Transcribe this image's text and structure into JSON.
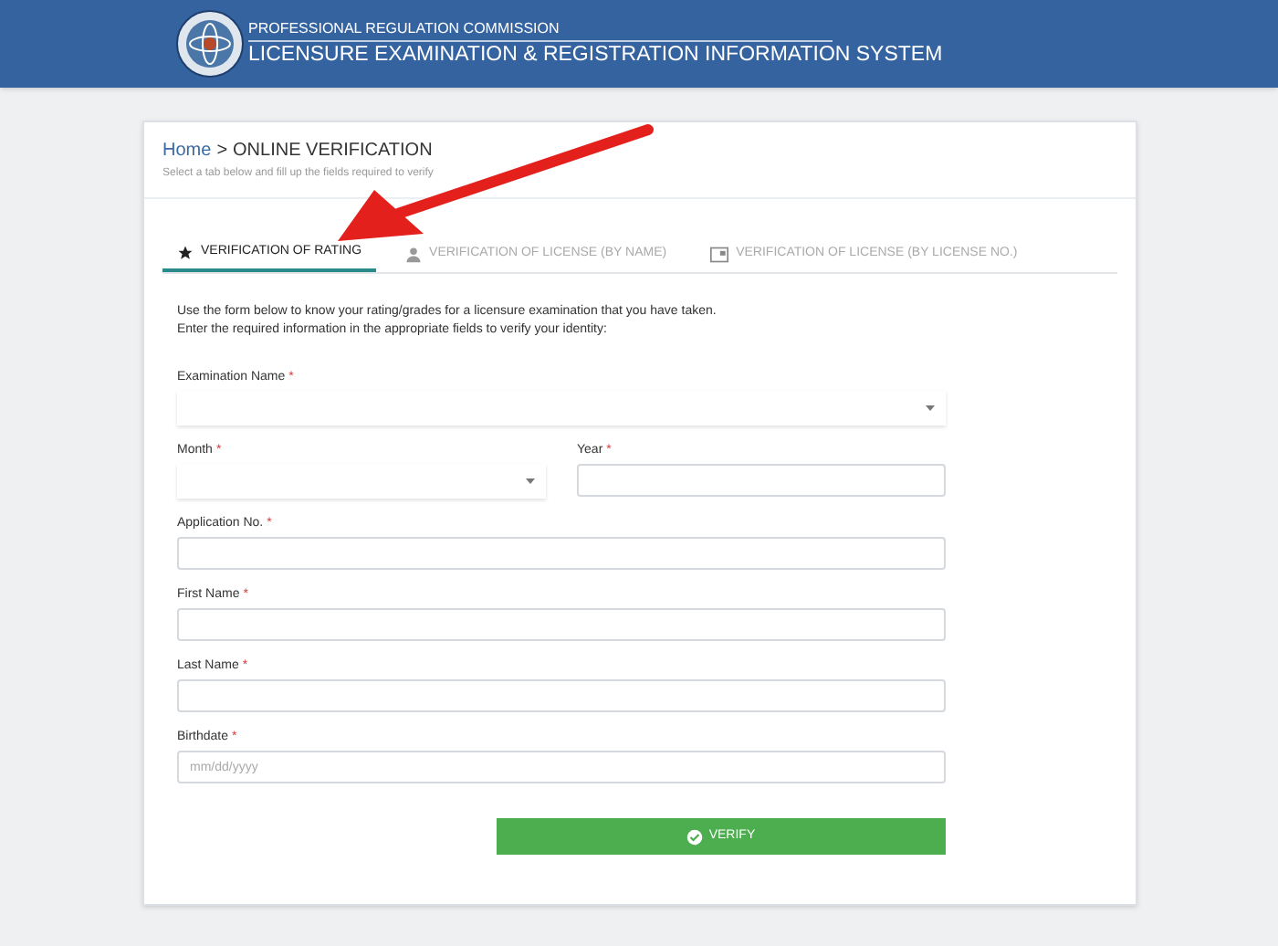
{
  "header": {
    "org": "PROFESSIONAL REGULATION COMMISSION",
    "system": "LICENSURE EXAMINATION & REGISTRATION INFORMATION SYSTEM"
  },
  "breadcrumb": {
    "home": "Home",
    "separator": ">",
    "current": "ONLINE VERIFICATION",
    "subtitle": "Select a tab below and fill up the fields required to verify"
  },
  "tabs": [
    {
      "label": "VERIFICATION OF RATING",
      "selected": true
    },
    {
      "label": "VERIFICATION OF LICENSE (BY NAME)",
      "selected": false
    },
    {
      "label": "VERIFICATION OF LICENSE (BY LICENSE NO.)",
      "selected": false
    }
  ],
  "instructions": [
    "Use the form below to know your rating/grades for a licensure examination that you have taken.",
    "Enter the required information in the appropriate fields to verify your identity:"
  ],
  "fields": [
    {
      "label": "Examination Name",
      "required_mark": "*",
      "kind": "select"
    },
    {
      "label": "Month",
      "required_mark": "*",
      "kind": "select"
    },
    {
      "label": "Year",
      "required_mark": "*",
      "kind": "input"
    },
    {
      "label": "Application No.",
      "required_mark": "*",
      "kind": "input"
    },
    {
      "label": "First Name",
      "required_mark": "*",
      "kind": "input"
    },
    {
      "label": "Last Name",
      "required_mark": "*",
      "kind": "input"
    },
    {
      "label": "Birthdate",
      "required_mark": "*",
      "kind": "input",
      "placeholder": "mm/dd/yyyy"
    }
  ],
  "verify_button": {
    "label": "VERIFY"
  },
  "annotation": {
    "kind": "arrow"
  }
}
